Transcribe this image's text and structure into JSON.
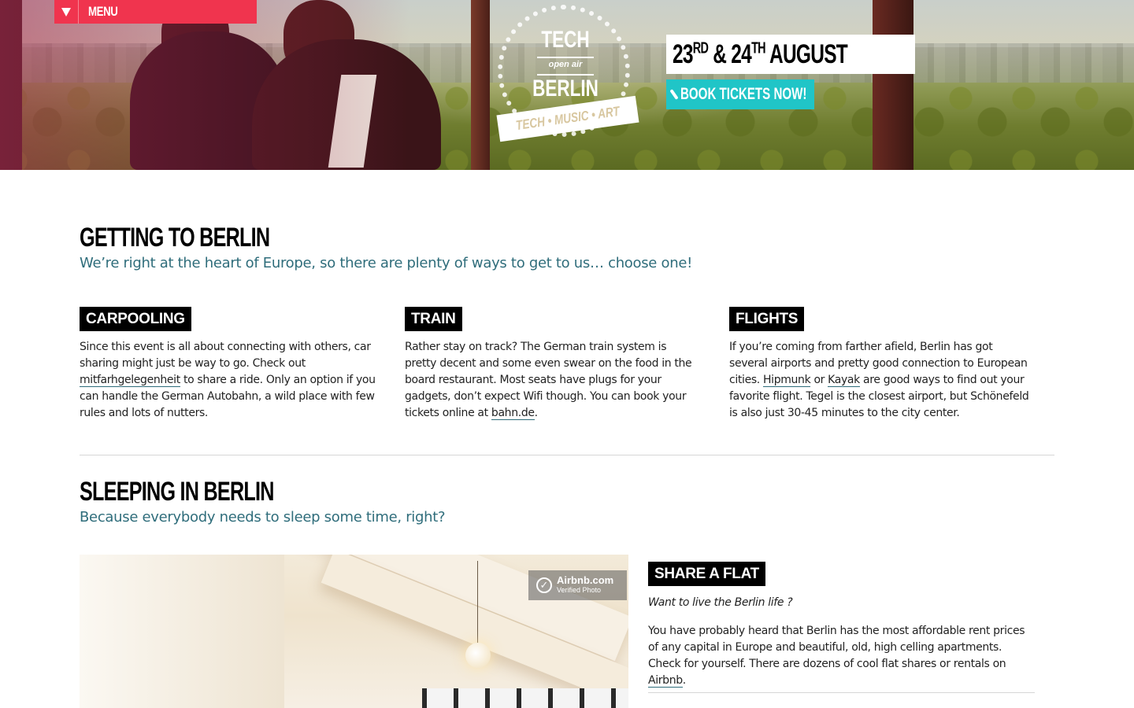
{
  "header": {
    "menu_label": "MENU",
    "logo": {
      "line1": "TECH",
      "line2": "open air",
      "line3": "BERLIN",
      "ribbon": "TECH • MUSIC • ART"
    },
    "date": {
      "day1": "23",
      "sup1": "RD",
      "amp": " & 24",
      "sup2": "TH",
      "month": " AUGUST"
    },
    "tickets_label": "BOOK TICKETS NOW!",
    "icons": [
      "menu-triangle-icon",
      "ticket-icon"
    ],
    "colors": {
      "menu": "#f0344e",
      "tickets": "#20c5c7"
    }
  },
  "getting": {
    "title": "GETTING TO BERLIN",
    "subtitle": "We’re right at the heart of Europe, so there are plenty of ways to get to us… choose one!",
    "columns": [
      {
        "tag": "CARPOOLING",
        "t1": "Since this event is all about connecting with others, car sharing might just be way to go. Check out ",
        "link1": "mitfarhgelegenheit",
        "t2": " to share a ride. Only an option if you can handle the German Autobahn, a wild place with few rules and lots of nutters."
      },
      {
        "tag": "TRAIN",
        "t1": "Rather stay on track? The German train system is pretty decent and some even swear on the food in the board restaurant. Most seats have plugs for your gadgets, don’t expect Wifi though. You can book your tickets online at ",
        "link1": "bahn.de",
        "t2": "."
      },
      {
        "tag": "FLIGHTS",
        "t1": "If you’re coming from farther afield, Berlin has got several airports and pretty good connection to European cities. ",
        "link1": "Hipmunk",
        "t2": " or ",
        "link2": "Kayak",
        "t3": " are good ways to find out your favorite flight. Tegel is the closest airport, but Schönefeld is also just 30-45 minutes to the city center."
      }
    ]
  },
  "sleeping": {
    "title": "SLEEPING IN BERLIN",
    "subtitle": "Because everybody needs to sleep some time, right?",
    "photo_stamp": {
      "line1": "Airbnb.com",
      "line2": "Verified Photo"
    },
    "share": {
      "tag": "SHARE A FLAT",
      "lead": "Want to live the Berlin life ?",
      "t1": "You have probably heard that Berlin has the most affordable rent prices of any capital in Europe and beautiful, old, high celling apartments. Check for yourself. There are dozens of cool flat shares or rentals on ",
      "link1": "Airbnb",
      "t2": "."
    }
  }
}
